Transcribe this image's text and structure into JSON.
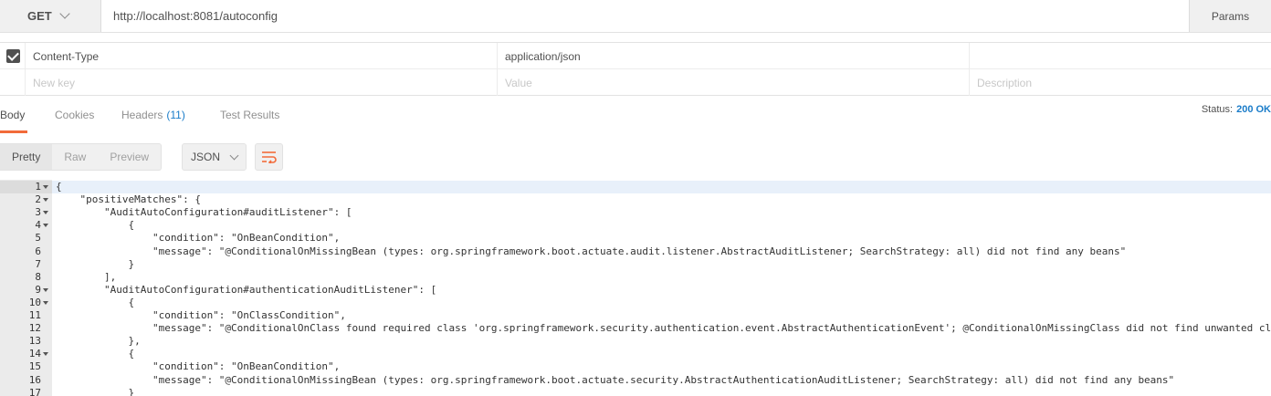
{
  "request": {
    "method": "GET",
    "url": "http://localhost:8081/autoconfig",
    "params_label": "Params"
  },
  "headers_table": {
    "rows": [
      {
        "checked": true,
        "key": "Content-Type",
        "value": "application/json",
        "description": ""
      }
    ],
    "new_row": {
      "key_placeholder": "New key",
      "value_placeholder": "Value",
      "description_placeholder": "Description"
    }
  },
  "response_tabs": {
    "body": "Body",
    "cookies": "Cookies",
    "headers": "Headers",
    "headers_count": "(11)",
    "test_results": "Test Results"
  },
  "status": {
    "label": "Status:",
    "value": "200 OK"
  },
  "view": {
    "pretty": "Pretty",
    "raw": "Raw",
    "preview": "Preview",
    "format": "JSON",
    "active": "pretty"
  },
  "icons": {
    "method_dropdown": "chevron-down-icon",
    "format_dropdown": "chevron-down-icon",
    "wrap": "wrap-lines-icon",
    "checkbox": "check-icon"
  },
  "colors": {
    "accent": "#f26b3a",
    "link_blue": "#1a7cc9",
    "json_key": "#2a2a9a"
  },
  "code_lines": [
    {
      "n": "1",
      "fold": true,
      "text": "{"
    },
    {
      "n": "2",
      "fold": true,
      "text": "    \"positiveMatches\": {"
    },
    {
      "n": "3",
      "fold": true,
      "text": "        \"AuditAutoConfiguration#auditListener\": ["
    },
    {
      "n": "4",
      "fold": true,
      "text": "            {"
    },
    {
      "n": "5",
      "fold": false,
      "text": "                \"condition\": \"OnBeanCondition\","
    },
    {
      "n": "6",
      "fold": false,
      "text": "                \"message\": \"@ConditionalOnMissingBean (types: org.springframework.boot.actuate.audit.listener.AbstractAuditListener; SearchStrategy: all) did not find any beans\""
    },
    {
      "n": "7",
      "fold": false,
      "text": "            }"
    },
    {
      "n": "8",
      "fold": false,
      "text": "        ],"
    },
    {
      "n": "9",
      "fold": true,
      "text": "        \"AuditAutoConfiguration#authenticationAuditListener\": ["
    },
    {
      "n": "10",
      "fold": true,
      "text": "            {"
    },
    {
      "n": "11",
      "fold": false,
      "text": "                \"condition\": \"OnClassCondition\","
    },
    {
      "n": "12",
      "fold": false,
      "text": "                \"message\": \"@ConditionalOnClass found required class 'org.springframework.security.authentication.event.AbstractAuthenticationEvent'; @ConditionalOnMissingClass did not find unwanted cla"
    },
    {
      "n": "13",
      "fold": false,
      "text": "            },"
    },
    {
      "n": "14",
      "fold": true,
      "text": "            {"
    },
    {
      "n": "15",
      "fold": false,
      "text": "                \"condition\": \"OnBeanCondition\","
    },
    {
      "n": "16",
      "fold": false,
      "text": "                \"message\": \"@ConditionalOnMissingBean (types: org.springframework.boot.actuate.security.AbstractAuthenticationAuditListener; SearchStrategy: all) did not find any beans\""
    },
    {
      "n": "17",
      "fold": false,
      "text": "            }"
    }
  ]
}
